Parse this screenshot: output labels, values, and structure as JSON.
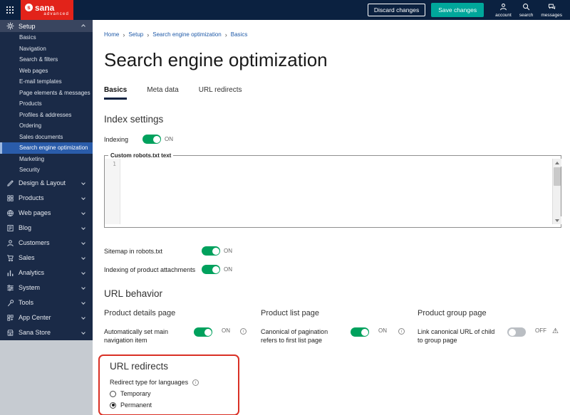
{
  "topbar": {
    "brand": "sana",
    "brand_sub": "advanced",
    "discard_label": "Discard changes",
    "save_label": "Save changes",
    "account_label": "account",
    "search_label": "search",
    "messages_label": "messages"
  },
  "sidebar": {
    "setup_label": "Setup",
    "setup_children": [
      "Basics",
      "Navigation",
      "Search & filters",
      "Web pages",
      "E-mail templates",
      "Page elements & messages",
      "Products",
      "Profiles & addresses",
      "Ordering",
      "Sales documents",
      "Search engine optimization",
      "Marketing",
      "Security"
    ],
    "active_child": "Search engine optimization",
    "items": [
      "Design & Layout",
      "Products",
      "Web pages",
      "Blog",
      "Customers",
      "Sales",
      "Analytics",
      "System",
      "Tools",
      "App Center",
      "Sana Store"
    ]
  },
  "breadcrumb": {
    "items": [
      "Home",
      "Setup",
      "Search engine optimization",
      "Basics"
    ],
    "separator": "›"
  },
  "page_title": "Search engine optimization",
  "tabs": {
    "items": [
      "Basics",
      "Meta data",
      "URL redirects"
    ],
    "active": "Basics"
  },
  "index_settings": {
    "heading": "Index settings",
    "indexing": {
      "label": "Indexing",
      "state": "ON"
    },
    "robots": {
      "legend": "Custom robots.txt text",
      "line_number": "1",
      "content": ""
    },
    "sitemap": {
      "label": "Sitemap in robots.txt",
      "state": "ON"
    },
    "attachments": {
      "label": "Indexing of product attachments",
      "state": "ON"
    }
  },
  "url_behavior": {
    "heading": "URL behavior",
    "columns": [
      {
        "heading": "Product details page",
        "setting": "Automatically set main navigation item",
        "state": "ON"
      },
      {
        "heading": "Product list page",
        "setting": "Canonical of pagination refers to first list page",
        "state": "ON"
      },
      {
        "heading": "Product group page",
        "setting": "Link canonical URL of child to group page",
        "state": "OFF"
      }
    ]
  },
  "url_redirects": {
    "heading": "URL redirects",
    "redirect_type_label": "Redirect type for languages",
    "options": [
      {
        "label": "Temporary",
        "selected": false
      },
      {
        "label": "Permanent",
        "selected": true
      }
    ]
  },
  "colors": {
    "topbar_bg": "#0b2140",
    "sidebar_bg": "#1a2a47",
    "brand_red": "#e2231a",
    "save_button": "#00a79b",
    "toggle_on": "#00a15d",
    "active_item_blue": "#2a5caa",
    "link_blue": "#1f5aa8",
    "annotation_red": "#d93025"
  }
}
